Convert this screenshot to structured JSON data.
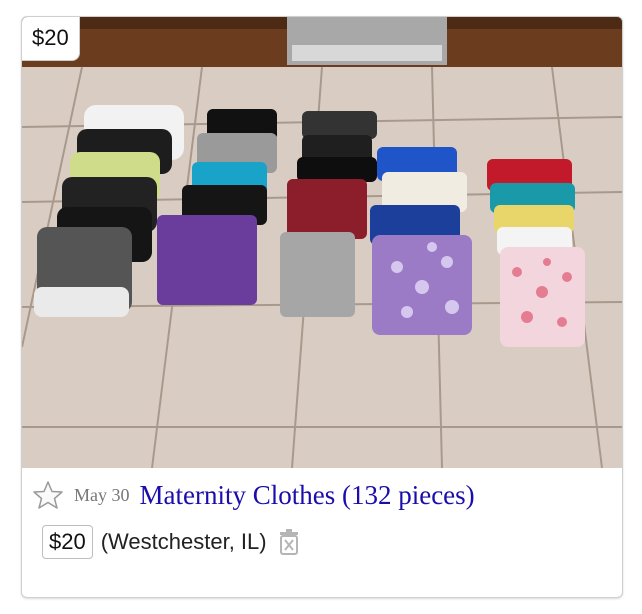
{
  "listing": {
    "badge_price": "$20",
    "date": "May 30",
    "title": "Maternity Clothes (132 pieces)",
    "price": "$20",
    "location": "(Westchester, IL)"
  },
  "icons": {
    "favorite": "star-outline-icon",
    "hide": "trash-hide-icon"
  },
  "colors": {
    "title_link": "#1a0dab",
    "date_text": "#777777"
  }
}
